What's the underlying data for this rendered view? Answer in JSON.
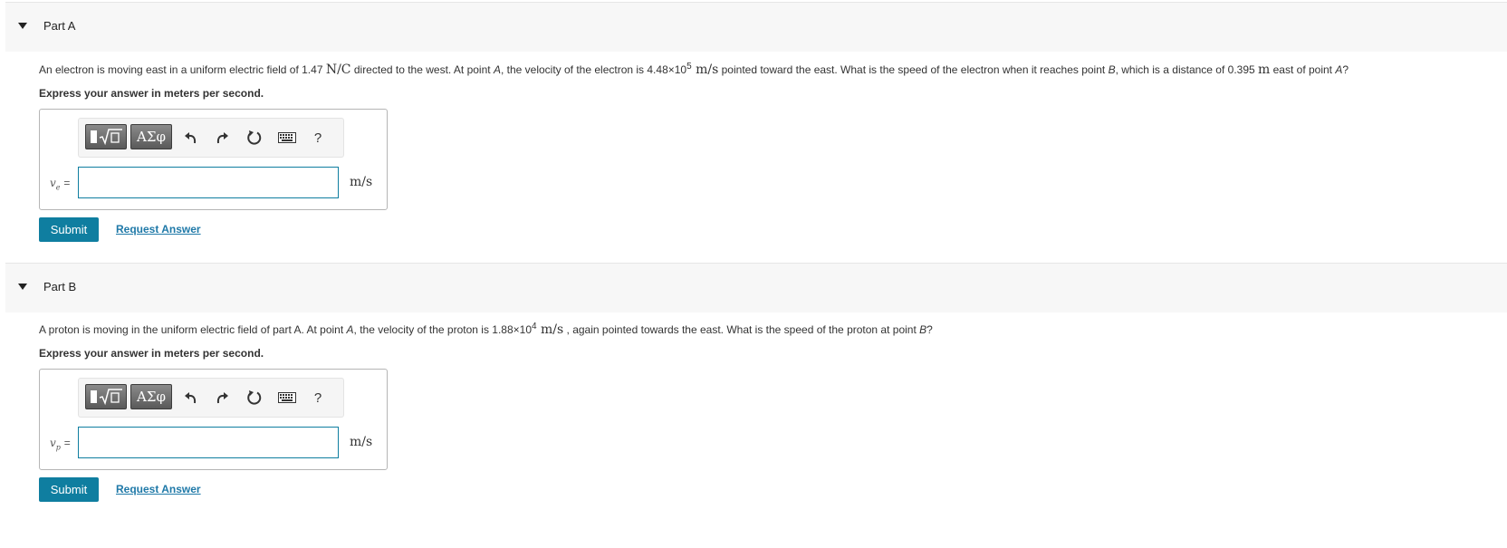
{
  "colors": {
    "header_bg": "#f7f7f7",
    "submit_bg": "#0f7ea0",
    "link": "#1f79a8",
    "input_border": "#0f7ea0"
  },
  "parts": [
    {
      "title": "Part A",
      "question": {
        "t1": "An electron is moving east in a uniform electric field of 1.47 ",
        "u1": "N/C",
        "t2": " directed to the west. At point ",
        "p1": "A",
        "t3": ", the velocity of the electron is 4.48×10",
        "exp": "5",
        "u2": " m/s",
        "t4": " pointed toward the east. What is the speed of the electron when it reaches point ",
        "p2": "B",
        "t5": ", which is a distance of 0.395 ",
        "u3": "m",
        "t6": " east of point ",
        "p3": "A",
        "t7": "?"
      },
      "instruction": "Express your answer in meters per second.",
      "variable": "v",
      "variable_sub": "e",
      "equals": "=",
      "input_value": "",
      "unit": "m/s",
      "toolbar": {
        "template_icon": "template-sqrt-icon",
        "symbols_label": "ΑΣφ",
        "undo_icon": "undo-icon",
        "redo_icon": "redo-icon",
        "reset_icon": "reset-icon",
        "keyboard_icon": "keyboard-icon",
        "help_label": "?"
      },
      "submit_label": "Submit",
      "request_label": "Request Answer"
    },
    {
      "title": "Part B",
      "question": {
        "t1": "A proton is moving in the uniform electric field of part A. At point ",
        "p1": "A",
        "t2": ", the velocity of the proton is 1.88×10",
        "exp": "4",
        "u1": " m/s",
        "t3": " , again pointed towards the east. What is the speed of the proton at point ",
        "p2": "B",
        "t4": "?"
      },
      "instruction": "Express your answer in meters per second.",
      "variable": "v",
      "variable_sub": "p",
      "equals": "=",
      "input_value": "",
      "unit": "m/s",
      "toolbar": {
        "template_icon": "template-sqrt-icon",
        "symbols_label": "ΑΣφ",
        "undo_icon": "undo-icon",
        "redo_icon": "redo-icon",
        "reset_icon": "reset-icon",
        "keyboard_icon": "keyboard-icon",
        "help_label": "?"
      },
      "submit_label": "Submit",
      "request_label": "Request Answer"
    }
  ]
}
